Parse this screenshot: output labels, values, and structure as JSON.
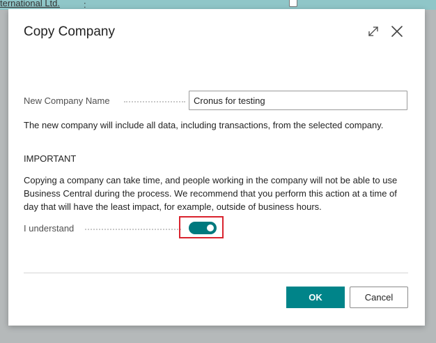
{
  "background": {
    "link_text": "ternational Ltd.",
    "colon": ":"
  },
  "dialog": {
    "title": "Copy Company",
    "expand_icon": "expand-diagonal-icon",
    "close_icon": "close-x-icon",
    "new_company_name": {
      "label": "New Company Name",
      "value": "Cronus for testing"
    },
    "info_text": "The new company will include all data, including transactions, from the selected company.",
    "important_heading": "IMPORTANT",
    "warning_text": "Copying a company can take time, and people working in the company will not be able to use Business Central during the process. We recommend that you perform this action at a time of day that will have the least impact, for example, outside of business hours.",
    "understand": {
      "label": "I understand",
      "checked": true
    },
    "ok_label": "OK",
    "cancel_label": "Cancel"
  },
  "colors": {
    "accent": "#008489",
    "toggle_on": "#00797e",
    "highlight": "#d9232e",
    "overlay": "#b5b9ba"
  }
}
